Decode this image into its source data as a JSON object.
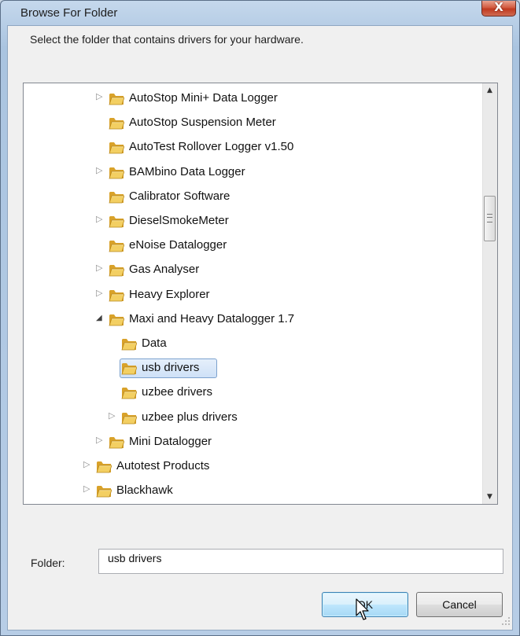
{
  "window": {
    "title": "Browse For Folder",
    "close_glyph": "X"
  },
  "dialog": {
    "instruction": "Select the folder that contains drivers for your hardware."
  },
  "tree": {
    "items": [
      {
        "label": "AutoStop Mini+ Data Logger",
        "level": 2,
        "expander": "collapsed",
        "selected": false
      },
      {
        "label": "AutoStop Suspension Meter",
        "level": 2,
        "expander": "none",
        "selected": false
      },
      {
        "label": "AutoTest Rollover Logger v1.50",
        "level": 2,
        "expander": "none",
        "selected": false
      },
      {
        "label": "BAMbino Data Logger",
        "level": 2,
        "expander": "collapsed",
        "selected": false
      },
      {
        "label": "Calibrator Software",
        "level": 2,
        "expander": "none",
        "selected": false
      },
      {
        "label": "DieselSmokeMeter",
        "level": 2,
        "expander": "collapsed",
        "selected": false
      },
      {
        "label": "eNoise Datalogger",
        "level": 2,
        "expander": "none",
        "selected": false
      },
      {
        "label": "Gas Analyser",
        "level": 2,
        "expander": "collapsed",
        "selected": false
      },
      {
        "label": "Heavy Explorer",
        "level": 2,
        "expander": "collapsed",
        "selected": false
      },
      {
        "label": "Maxi and Heavy Datalogger 1.7",
        "level": 2,
        "expander": "expanded",
        "selected": false
      },
      {
        "label": "Data",
        "level": 3,
        "expander": "none",
        "selected": false
      },
      {
        "label": "usb drivers",
        "level": 3,
        "expander": "none",
        "selected": true
      },
      {
        "label": "uzbee drivers",
        "level": 3,
        "expander": "none",
        "selected": false
      },
      {
        "label": "uzbee plus drivers",
        "level": 3,
        "expander": "collapsed",
        "selected": false
      },
      {
        "label": "Mini Datalogger",
        "level": 2,
        "expander": "collapsed",
        "selected": false
      },
      {
        "label": "Autotest Products",
        "level": 1,
        "expander": "collapsed",
        "selected": false
      },
      {
        "label": "Blackhawk",
        "level": 1,
        "expander": "collapsed",
        "selected": false
      }
    ],
    "scroll_position": 0.42
  },
  "folder": {
    "label": "Folder:",
    "value": "usb drivers"
  },
  "buttons": {
    "ok": "OK",
    "cancel": "Cancel"
  },
  "colors": {
    "selection_fill": "#cfe1f7",
    "selection_border": "#7da2ce",
    "folder_yellow": "#e8b83c",
    "close_red": "#c0391f"
  }
}
